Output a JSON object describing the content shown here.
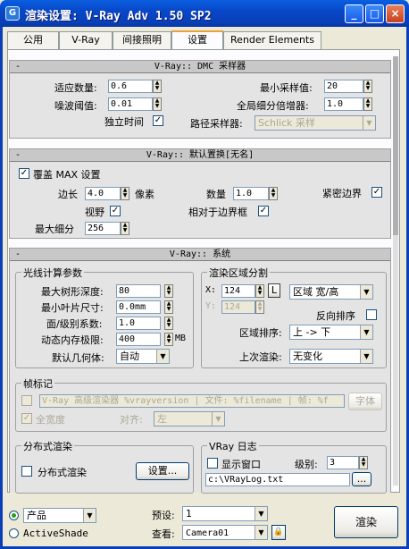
{
  "window": {
    "title": "渲染设置: V-Ray Adv 1.50 SP2",
    "min": "_",
    "max": "□",
    "close": "×"
  },
  "tabs": [
    {
      "label": "公用"
    },
    {
      "label": "V-Ray"
    },
    {
      "label": "间接照明"
    },
    {
      "label": "设置"
    },
    {
      "label": "Render Elements"
    }
  ],
  "active_tab": "设置",
  "dmc": {
    "title": "V-Ray:: DMC 采样器",
    "minus": "-",
    "adaptive_label": "适应数量:",
    "adaptive": "0.6",
    "min_samples_label": "最小采样值:",
    "min_samples": "20",
    "noise_label": "噪波阈值:",
    "noise": "0.01",
    "global_label": "全局细分倍增器:",
    "global": "1.0",
    "indep_label": "独立时间",
    "indep_checked": "✓",
    "path_label": "路径采样器:",
    "path": "Schlick 采样"
  },
  "displace": {
    "title": "V-Ray:: 默认置换[无名]",
    "minus": "-",
    "override_label": "覆盖 MAX 设置",
    "override_checked": "✓",
    "edge_label": "边长",
    "edge": "4.0",
    "pixels_label": "像素",
    "amount_label": "数量",
    "amount": "1.0",
    "tight_label": "紧密边界",
    "tight_checked": "✓",
    "view_label": "视野",
    "view_checked": "✓",
    "relative_label": "相对于边界框",
    "relative_checked": "✓",
    "maxsub_label": "最大细分",
    "maxsub": "256"
  },
  "system": {
    "title": "V-Ray:: 系统",
    "minus": "-",
    "raycast_title": "光线计算参数",
    "maxtree_label": "最大树形深度:",
    "maxtree": "80",
    "minleaf_label": "最小叶片尺寸:",
    "minleaf": "0.0mm",
    "facelevel_label": "面/级别系数:",
    "facelevel": "1.0",
    "dynmem_label": "动态内存极限:",
    "dynmem": "400",
    "mb": "MB",
    "defgeom_label": "默认几何体:",
    "defgeom": "自动",
    "region_title": "渲染区域分割",
    "x_label": "X:",
    "x": "124",
    "l": "L",
    "region_mode": "区域 宽/高",
    "y_label": "Y:",
    "y": "124",
    "reverse_label": "反向排序",
    "order_label": "区域排序:",
    "order": "上 -> 下",
    "last_label": "上次渲染:",
    "last": "无变化",
    "stamp_title": "帧标记",
    "stamp_text": "V-Ray 高级渲染器 %vrayversion | 文件: %filename | 帧: %f",
    "font_btn": "字体",
    "fullwidth_label": "全宽度",
    "fullwidth_checked": "✓",
    "align_label": "对齐:",
    "align": "左",
    "distrib_title": "分布式渲染",
    "distrib_label": "分布式渲染",
    "settings_btn": "设置...",
    "log_title": "VRay 日志",
    "showwin_label": "显示窗口",
    "level_label": "级别:",
    "level": "3",
    "logfile": "c:\\VRayLog.txt",
    "browse": "..."
  },
  "bottom": {
    "product_label": "产品",
    "activeshade_label": "ActiveShade",
    "preset_label": "预设:",
    "preset": "1",
    "view_label": "查看:",
    "view": "Camera01",
    "lock": "🔒",
    "render_btn": "渲染"
  }
}
